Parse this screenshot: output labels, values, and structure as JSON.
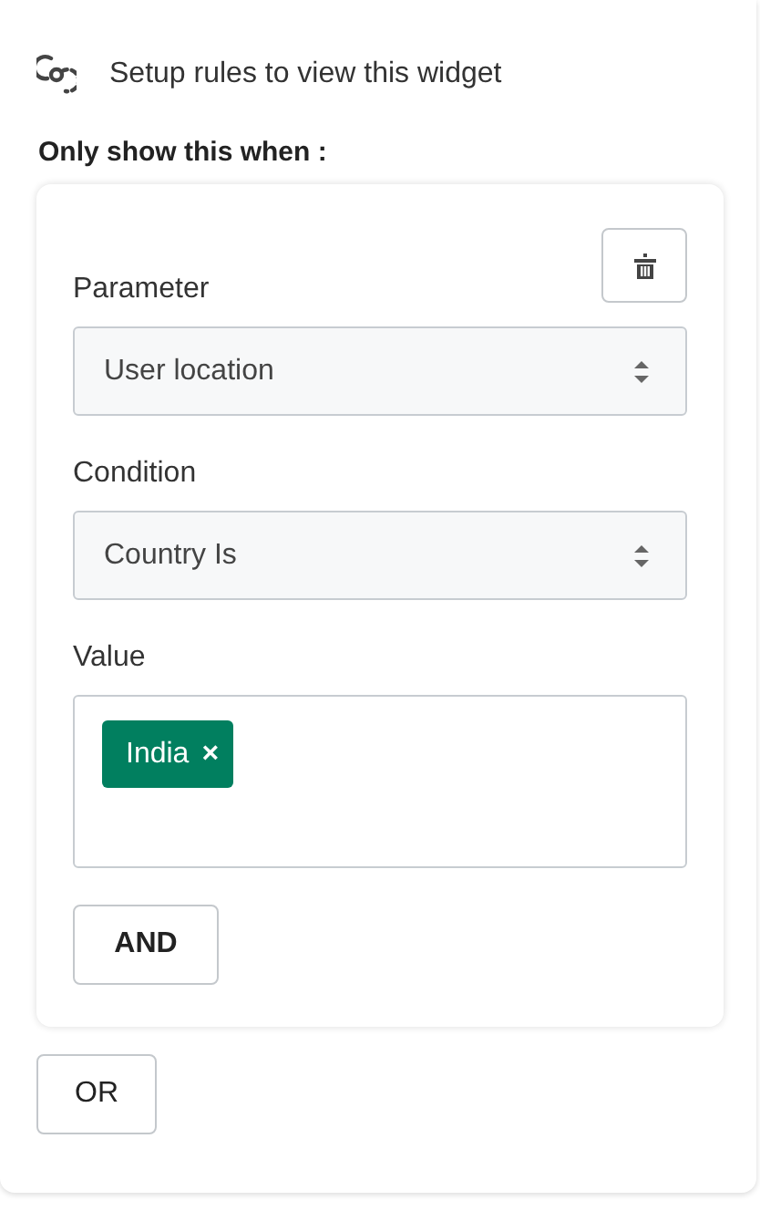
{
  "header": {
    "title": "Setup rules to view this widget"
  },
  "section_title": "Only show this when :",
  "rule": {
    "fields": [
      {
        "kind": "select",
        "label": "Parameter",
        "value": "User location"
      },
      {
        "kind": "select",
        "label": "Condition",
        "value": "Country Is"
      },
      {
        "kind": "tags",
        "label": "Value",
        "tags": [
          {
            "label": "India",
            "remove": "×",
            "color": "#017f5f"
          }
        ]
      }
    ],
    "and_button": "AND"
  },
  "or_button": "OR"
}
